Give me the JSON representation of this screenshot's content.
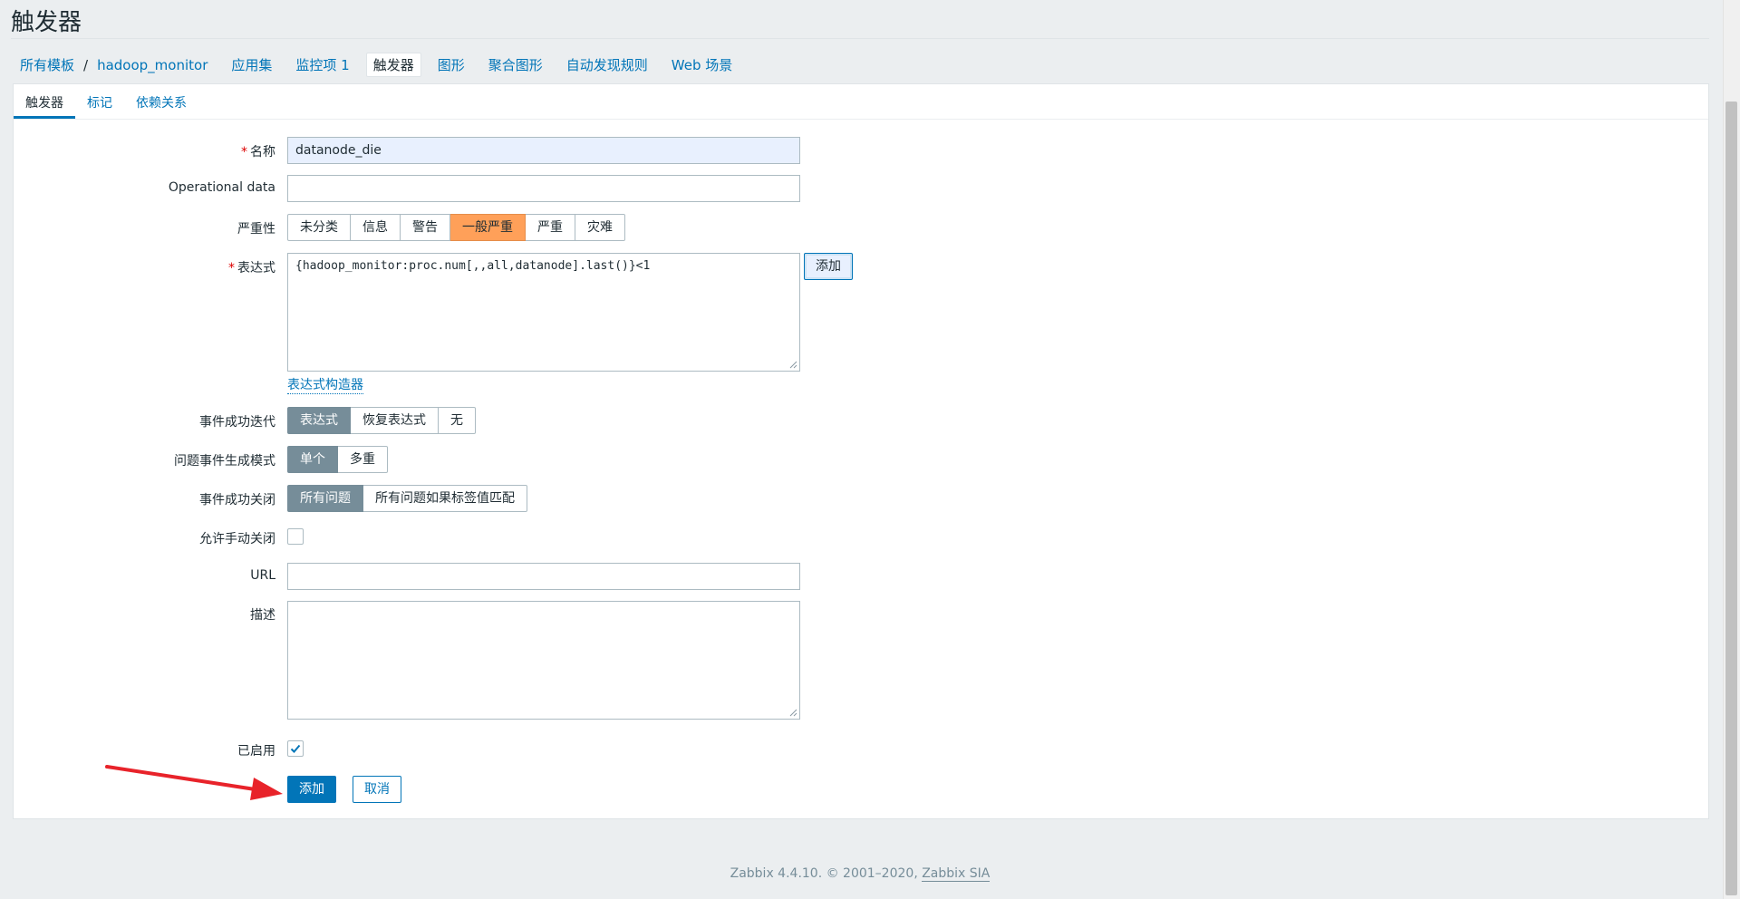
{
  "page": {
    "title": "触发器"
  },
  "breadcrumbs": {
    "items": [
      {
        "label": "所有模板"
      },
      {
        "separator": "/"
      },
      {
        "label": "hadoop_monitor"
      },
      {
        "label": "应用集"
      },
      {
        "label": "监控项 1"
      },
      {
        "label": "触发器",
        "active": true
      },
      {
        "label": "图形"
      },
      {
        "label": "聚合图形"
      },
      {
        "label": "自动发现规则"
      },
      {
        "label": "Web 场景"
      }
    ]
  },
  "tabs": [
    {
      "label": "触发器",
      "active": true
    },
    {
      "label": "标记"
    },
    {
      "label": "依赖关系"
    }
  ],
  "form": {
    "required_mark": "*",
    "name": {
      "label": "名称",
      "value": "datanode_die"
    },
    "operational_data": {
      "label": "Operational data",
      "value": ""
    },
    "severity": {
      "label": "严重性",
      "options": [
        "未分类",
        "信息",
        "警告",
        "一般严重",
        "严重",
        "灾难"
      ],
      "selected": "一般严重"
    },
    "expression": {
      "label": "表达式",
      "value": "{hadoop_monitor:proc.num[,,all,datanode].last()}<1",
      "add_button": "添加",
      "constructor_link": "表达式构造器"
    },
    "ok_event_generation": {
      "label": "事件成功迭代",
      "options": [
        "表达式",
        "恢复表达式",
        "无"
      ],
      "selected": "表达式"
    },
    "problem_event_mode": {
      "label": "问题事件生成模式",
      "options": [
        "单个",
        "多重"
      ],
      "selected": "单个"
    },
    "ok_event_closes": {
      "label": "事件成功关闭",
      "options": [
        "所有问题",
        "所有问题如果标签值匹配"
      ],
      "selected": "所有问题"
    },
    "allow_manual_close": {
      "label": "允许手动关闭",
      "checked": false
    },
    "url": {
      "label": "URL",
      "value": ""
    },
    "description": {
      "label": "描述",
      "value": ""
    },
    "enabled": {
      "label": "已启用",
      "checked": true
    },
    "submit_button": "添加",
    "cancel_button": "取消"
  },
  "footer": {
    "text": "Zabbix 4.4.10. © 2001–2020, ",
    "link": "Zabbix SIA"
  },
  "colors": {
    "accent": "#0275b8",
    "severity_selected": "#ffa059",
    "toggle_selected": "#768d99",
    "annotation_arrow": "#e8232a"
  }
}
